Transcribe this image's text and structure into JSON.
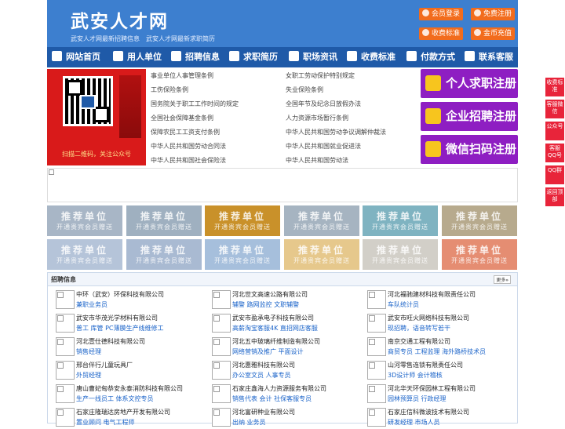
{
  "header": {
    "title": "武安人才网",
    "subtitle": "武安人才网最新招聘信息　武安人才网最新求职简历",
    "buttons": [
      "会员登录",
      "免费注册",
      "收费标准",
      "金币充值"
    ]
  },
  "nav": [
    "网站首页",
    "用人单位",
    "招聘信息",
    "求职简历",
    "职场资讯",
    "收费标准",
    "付款方式",
    "联系客服"
  ],
  "qr": {
    "caption": "扫描二维码，关注公众号"
  },
  "links": {
    "left": [
      "事业单位人事管理条例",
      "工伤保险条例",
      "国务院关于职工工作时间的规定",
      "全国社会保障基金条例",
      "保障农民工工资支付条例",
      "中华人民共和国劳动合同法",
      "中华人民共和国社会保险法"
    ],
    "right": [
      "女职工劳动保护特别规定",
      "失业保险条例",
      "全国年节及纪念日放假办法",
      "人力资源市场暂行条例",
      "中华人民共和国劳动争议调解仲裁法",
      "中华人民共和国就业促进法",
      "中华人民共和国劳动法"
    ]
  },
  "register": [
    "个人求职注册",
    "企业招聘注册",
    "微信扫码注册"
  ],
  "tiles": {
    "title": "推荐单位",
    "sub": "开通贵宾会员赠送",
    "colors": [
      "#a8b6c6",
      "#9fb0c0",
      "#c9912a",
      "#a6b4c1",
      "#7fb3c1",
      "#b7aa8d",
      "#b5c4d9",
      "#a9bad2",
      "#a6bfdc",
      "#e6c88c",
      "#d2cfc8",
      "#e58d72"
    ]
  },
  "jobs": {
    "title": "招聘信息",
    "more": "更多»",
    "items": [
      {
        "company": "中环（武安）环保科技有限公司",
        "positions": "兼职业务员"
      },
      {
        "company": "河北世文高速公路有限公司",
        "positions": "辅警 路网监控 文职辅警"
      },
      {
        "company": "河北福驰建材科技有限责任公司",
        "positions": "车队统计员"
      },
      {
        "company": "武安市华茂光学材料有限公司",
        "positions": "普工 库管 PC薄膜生产线维修工"
      },
      {
        "company": "武安市盈承电子科技有限公司",
        "positions": "高薪淘宝客服4K 直招网店客服"
      },
      {
        "company": "武安市旺火网络科技有限公司",
        "positions": "现招聘，语音转写若干"
      },
      {
        "company": "河北壹仕德科技有限公司",
        "positions": "销售经理"
      },
      {
        "company": "河北五中玻璃纤维制造有限公司",
        "positions": "网络营销及推广 平面设计"
      },
      {
        "company": "南京交通工程有限公司",
        "positions": "商贸专员 工程监理 海外路桥技术员"
      },
      {
        "company": "邢台伴行儿童玩具厂",
        "positions": "外贸经理"
      },
      {
        "company": "河北惠雅科技有限公司",
        "positions": "办公室文员 人事专员"
      },
      {
        "company": "山河零售连锁有限责任公司",
        "positions": "3D设计师 会计稽核"
      },
      {
        "company": "唐山曹妃甸恭安永泰消防科技有限公司",
        "positions": "生产一线员工 体系文控专员"
      },
      {
        "company": "石家庄鑫海人力资源服务有限公司",
        "positions": "销售代表 会计 社保客服专员"
      },
      {
        "company": "河北华天环保园林工程有限公司",
        "positions": "园林预算员 行政经理"
      },
      {
        "company": "石家庄隆瑞达房地产开发有限公司",
        "positions": "置业顾问 电气工程师"
      },
      {
        "company": "河北富研种业有限公司",
        "positions": "出纳 业务员"
      },
      {
        "company": "石家庄信科微波技术有限公司",
        "positions": "研发经理 市场人员"
      }
    ]
  },
  "float": [
    "收费标准",
    "客服微信",
    "公众号",
    "客服QQ号",
    "QQ群",
    "返回顶部"
  ]
}
